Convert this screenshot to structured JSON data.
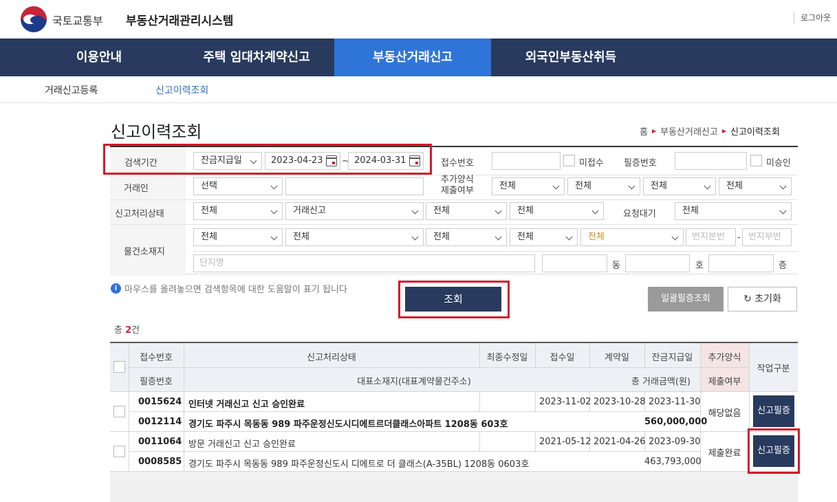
{
  "header": {
    "ministry": "국토교통부",
    "system_title": "부동산거래관리시스템",
    "logout": "로그아웃"
  },
  "main_nav": [
    "이용안내",
    "주택 임대차계약신고",
    "부동산거래신고",
    "외국인부동산취득"
  ],
  "sub_nav": [
    "거래신고등록",
    "신고이력조회"
  ],
  "page": {
    "title": "신고이력조회",
    "breadcrumb": [
      "홈",
      "부동산거래신고",
      "신고이력조회"
    ]
  },
  "search": {
    "period_label": "검색기간",
    "period_type": "잔금지급일",
    "date_from": "2023-04-23",
    "tilde": "~",
    "date_to": "2024-03-31",
    "receipt_no_label": "접수번호",
    "not_received": "미접수",
    "cert_no_label": "필증번호",
    "not_approved": "미승인",
    "party_label": "거래인",
    "party_select": "선택",
    "extra_form_label_1": "추가양식",
    "extra_form_label_2": "제출여부",
    "all": "전체",
    "status_label": "신고처리상태",
    "trade_report": "거래신고",
    "request_wait_label": "요청대기",
    "location_label": "물건소재지",
    "lot_main": "번지본번",
    "dash": "-",
    "lot_sub": "번지부번",
    "complex_name": "단지명",
    "dong": "동",
    "ho": "호",
    "floor": "층"
  },
  "help_text": "마우스를 올려놓으면 검색항목에 대한 도움말이 표기 됩니다",
  "buttons": {
    "search": "조회",
    "bulk_cert": "일괄필증조회",
    "reset": "초기화",
    "cert": "신고필증"
  },
  "total": {
    "prefix": "총 ",
    "count": "2",
    "suffix": "건"
  },
  "table": {
    "headers": {
      "receipt_no": "접수번호",
      "status": "신고처리상태",
      "last_modified": "최종수정일",
      "receipt_date": "접수일",
      "contract_date": "계약일",
      "balance_date": "잔금지급일",
      "extra_form_1": "추가양식",
      "extra_form_2": "제출여부",
      "work_type": "작업구분",
      "cert_no": "필증번호",
      "address": "대표소재지(대표계약물건주소)",
      "total_amount": "총 거래금액(원)"
    },
    "rows": [
      {
        "receipt_no": "0015624",
        "status": "인터넷 거래신고 신고 승인완료",
        "last_modified": "",
        "receipt_date": "2023-11-02",
        "contract_date": "2023-10-28",
        "balance_date": "2023-11-30",
        "cert_no": "0012114",
        "address": "경기도 파주시 목동동 989 파주운정신도시디에트르더클래스아파트 1208동 603호",
        "amount": "560,000,000",
        "extra": "해당없음"
      },
      {
        "receipt_no": "0011064",
        "status": "방문 거래신고 신고 승인완료",
        "last_modified": "",
        "receipt_date": "2021-05-12",
        "contract_date": "2021-04-26",
        "balance_date": "2023-09-30",
        "cert_no": "0008585",
        "address": "경기도 파주시 목동동 989 파주운정신도시 디에트로 더 클래스(A-35BL) 1208동 0603호",
        "amount": "463,793,000",
        "extra": "제출완료"
      }
    ]
  },
  "colors": {
    "nav_bg": "#283a5e",
    "nav_active": "#2f74d8",
    "highlight_red": "#d4182b"
  }
}
